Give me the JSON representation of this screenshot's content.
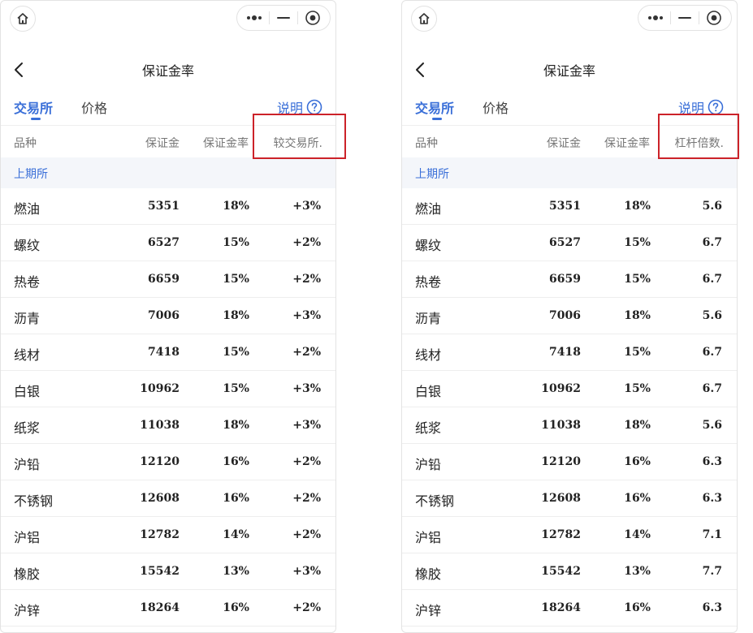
{
  "title": "保证金率",
  "tabs": {
    "exchange": "交易所",
    "price": "价格"
  },
  "explain_label": "说明",
  "section": "上期所",
  "columns": {
    "name": "品种",
    "margin": "保证金",
    "rate": "保证金率",
    "left_last": "较交易所.",
    "right_last": "杠杆倍数."
  },
  "rows": [
    {
      "name": "燃油",
      "margin": "5351",
      "rate": "18%",
      "vs_exchange": "+3%",
      "leverage": "5.6"
    },
    {
      "name": "螺纹",
      "margin": "6527",
      "rate": "15%",
      "vs_exchange": "+2%",
      "leverage": "6.7"
    },
    {
      "name": "热卷",
      "margin": "6659",
      "rate": "15%",
      "vs_exchange": "+2%",
      "leverage": "6.7"
    },
    {
      "name": "沥青",
      "margin": "7006",
      "rate": "18%",
      "vs_exchange": "+3%",
      "leverage": "5.6"
    },
    {
      "name": "线材",
      "margin": "7418",
      "rate": "15%",
      "vs_exchange": "+2%",
      "leverage": "6.7"
    },
    {
      "name": "白银",
      "margin": "10962",
      "rate": "15%",
      "vs_exchange": "+3%",
      "leverage": "6.7"
    },
    {
      "name": "纸浆",
      "margin": "11038",
      "rate": "18%",
      "vs_exchange": "+3%",
      "leverage": "5.6"
    },
    {
      "name": "沪铅",
      "margin": "12120",
      "rate": "16%",
      "vs_exchange": "+2%",
      "leverage": "6.3"
    },
    {
      "name": "不锈钢",
      "margin": "12608",
      "rate": "16%",
      "vs_exchange": "+2%",
      "leverage": "6.3"
    },
    {
      "name": "沪铝",
      "margin": "12782",
      "rate": "14%",
      "vs_exchange": "+2%",
      "leverage": "7.1"
    },
    {
      "name": "橡胶",
      "margin": "15542",
      "rate": "13%",
      "vs_exchange": "+3%",
      "leverage": "7.7"
    },
    {
      "name": "沪锌",
      "margin": "18264",
      "rate": "16%",
      "vs_exchange": "+2%",
      "leverage": "6.3"
    }
  ],
  "colors": {
    "accent": "#3a6fd8",
    "highlight": "#cc2229",
    "section_bg": "#f4f6fa"
  },
  "icons": {
    "home": "home-icon",
    "more": "more-dots-icon",
    "minimize": "minimize-icon",
    "close": "target-close-icon",
    "back": "chevron-left-icon",
    "help": "question-circle-icon"
  }
}
